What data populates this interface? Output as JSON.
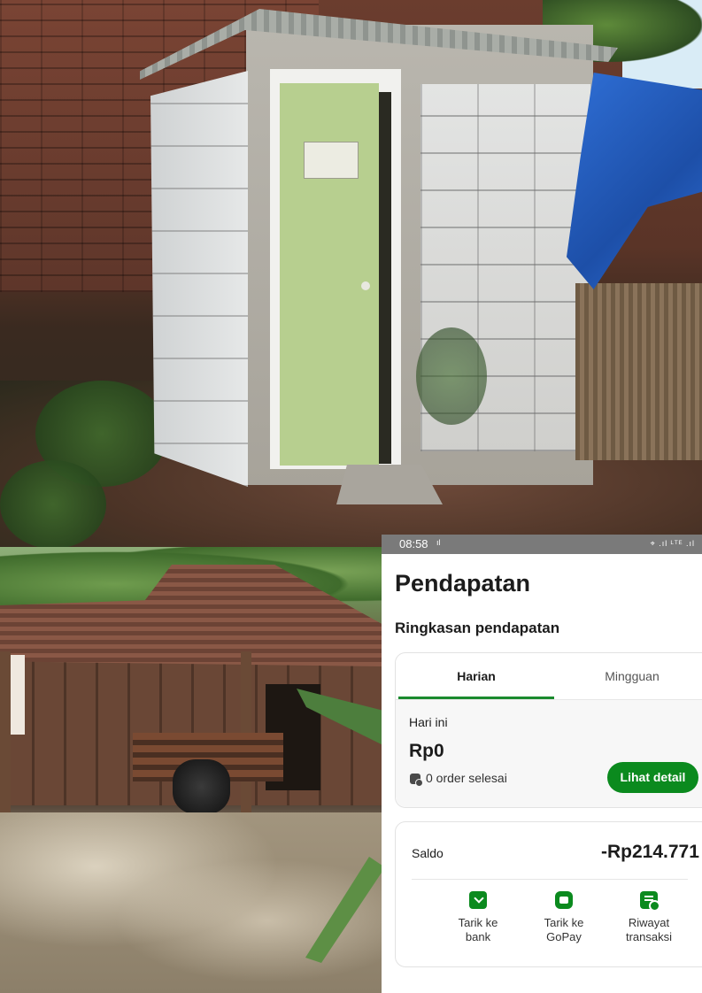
{
  "status_bar": {
    "time": "08:58",
    "wifi": "ıl",
    "indicators": "⌖ .ıl ᴸᵀᴱ .ıl"
  },
  "page": {
    "title": "Pendapatan",
    "section_title": "Ringkasan pendapatan"
  },
  "tabs": [
    {
      "label": "Harian",
      "active": true
    },
    {
      "label": "Mingguan",
      "active": false
    }
  ],
  "today": {
    "label": "Hari ini",
    "amount": "Rp0",
    "orders_text": "0 order selesai",
    "detail_button": "Lihat detail"
  },
  "balance": {
    "label": "Saldo",
    "value": "-Rp214.771"
  },
  "actions": [
    {
      "icon": "download-icon",
      "label_line1": "Tarik ke",
      "label_line2": "bank"
    },
    {
      "icon": "wallet-icon",
      "label_line1": "Tarik ke",
      "label_line2": "GoPay"
    },
    {
      "icon": "transaction-history-icon",
      "label_line1": "Riwayat",
      "label_line2": "transaksi"
    }
  ],
  "colors": {
    "accent_green": "#0b8a1e",
    "status_bar": "#7a7a7a"
  }
}
